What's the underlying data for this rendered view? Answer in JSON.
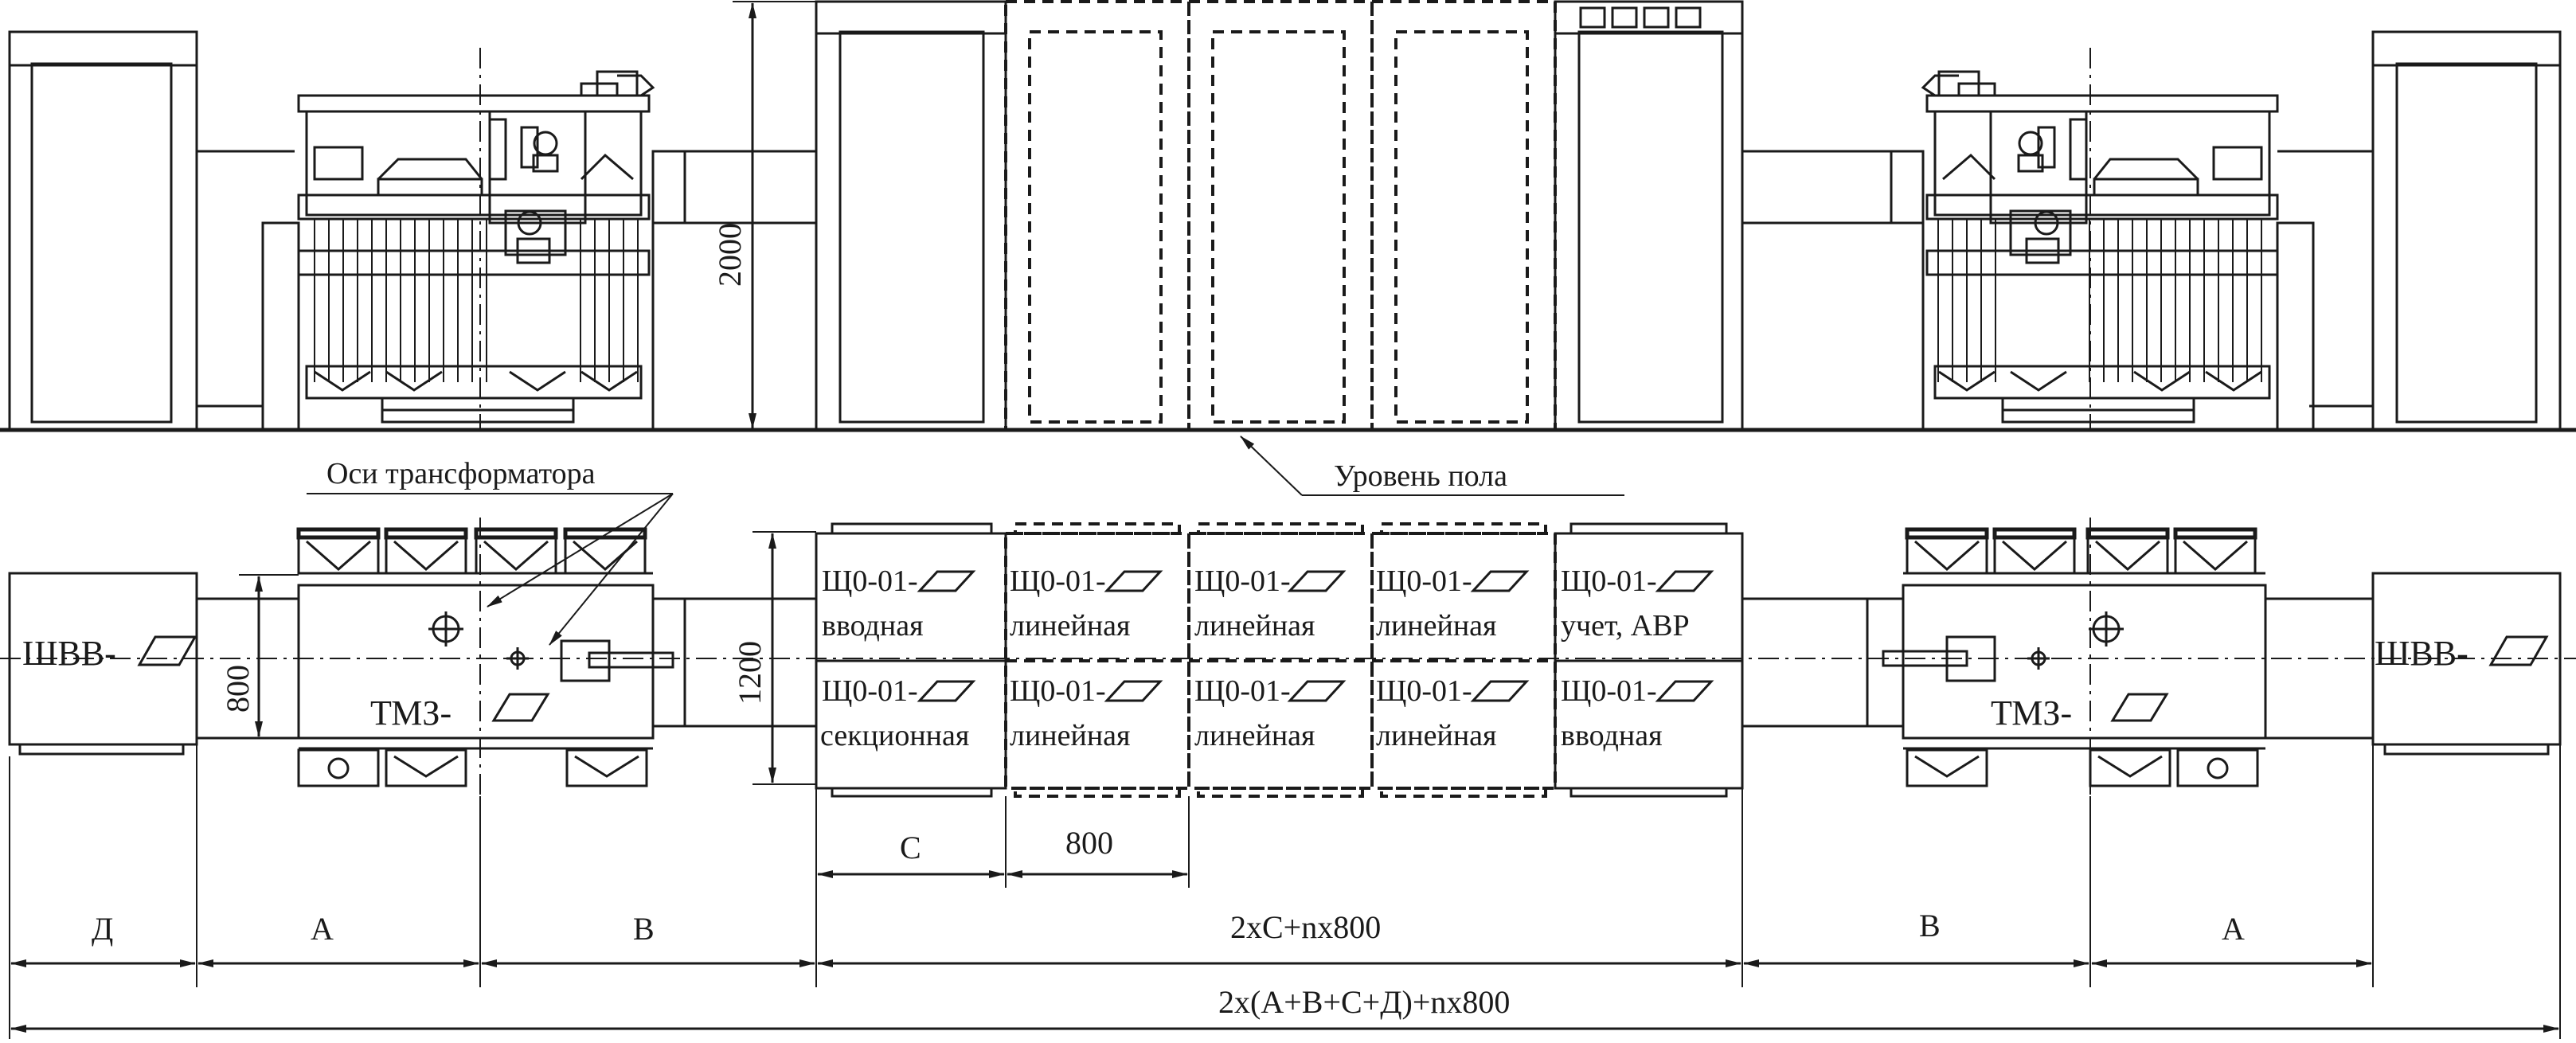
{
  "labels": {
    "transformer_axes": "Оси трансформатора",
    "floor_level": "Уровень пола",
    "height_dim": "2000",
    "width_dim": "800",
    "depth_dim": "1200",
    "shvv_left": "ШВВ-",
    "shvv_right": "ШВВ-",
    "tmz_left": "ТМЗ-",
    "tmz_right": "ТМЗ-"
  },
  "panels": {
    "p1_top": [
      "Щ0-01-",
      "вводная"
    ],
    "p1_bottom": [
      "Щ0-01-",
      "секционная"
    ],
    "p2_top": [
      "Щ0-01-",
      "линейная"
    ],
    "p2_bottom": [
      "Щ0-01-",
      "линейная"
    ],
    "p3_top": [
      "Щ0-01-",
      "линейная"
    ],
    "p3_bottom": [
      "Щ0-01-",
      "линейная"
    ],
    "p4_top": [
      "Щ0-01-",
      "линейная"
    ],
    "p4_bottom": [
      "Щ0-01-",
      "линейная"
    ],
    "p5_top": [
      "Щ0-01-",
      "учет, АВР"
    ],
    "p5_bottom": [
      "Щ0-01-",
      "вводная"
    ]
  },
  "dimensions": {
    "c": "С",
    "panel_800": "800",
    "d": "Д",
    "a_left": "А",
    "b_left": "В",
    "middle": "2хС+nх800",
    "b_right": "В",
    "a_right": "А",
    "total": "2х(А+В+С+Д)+nх800"
  }
}
